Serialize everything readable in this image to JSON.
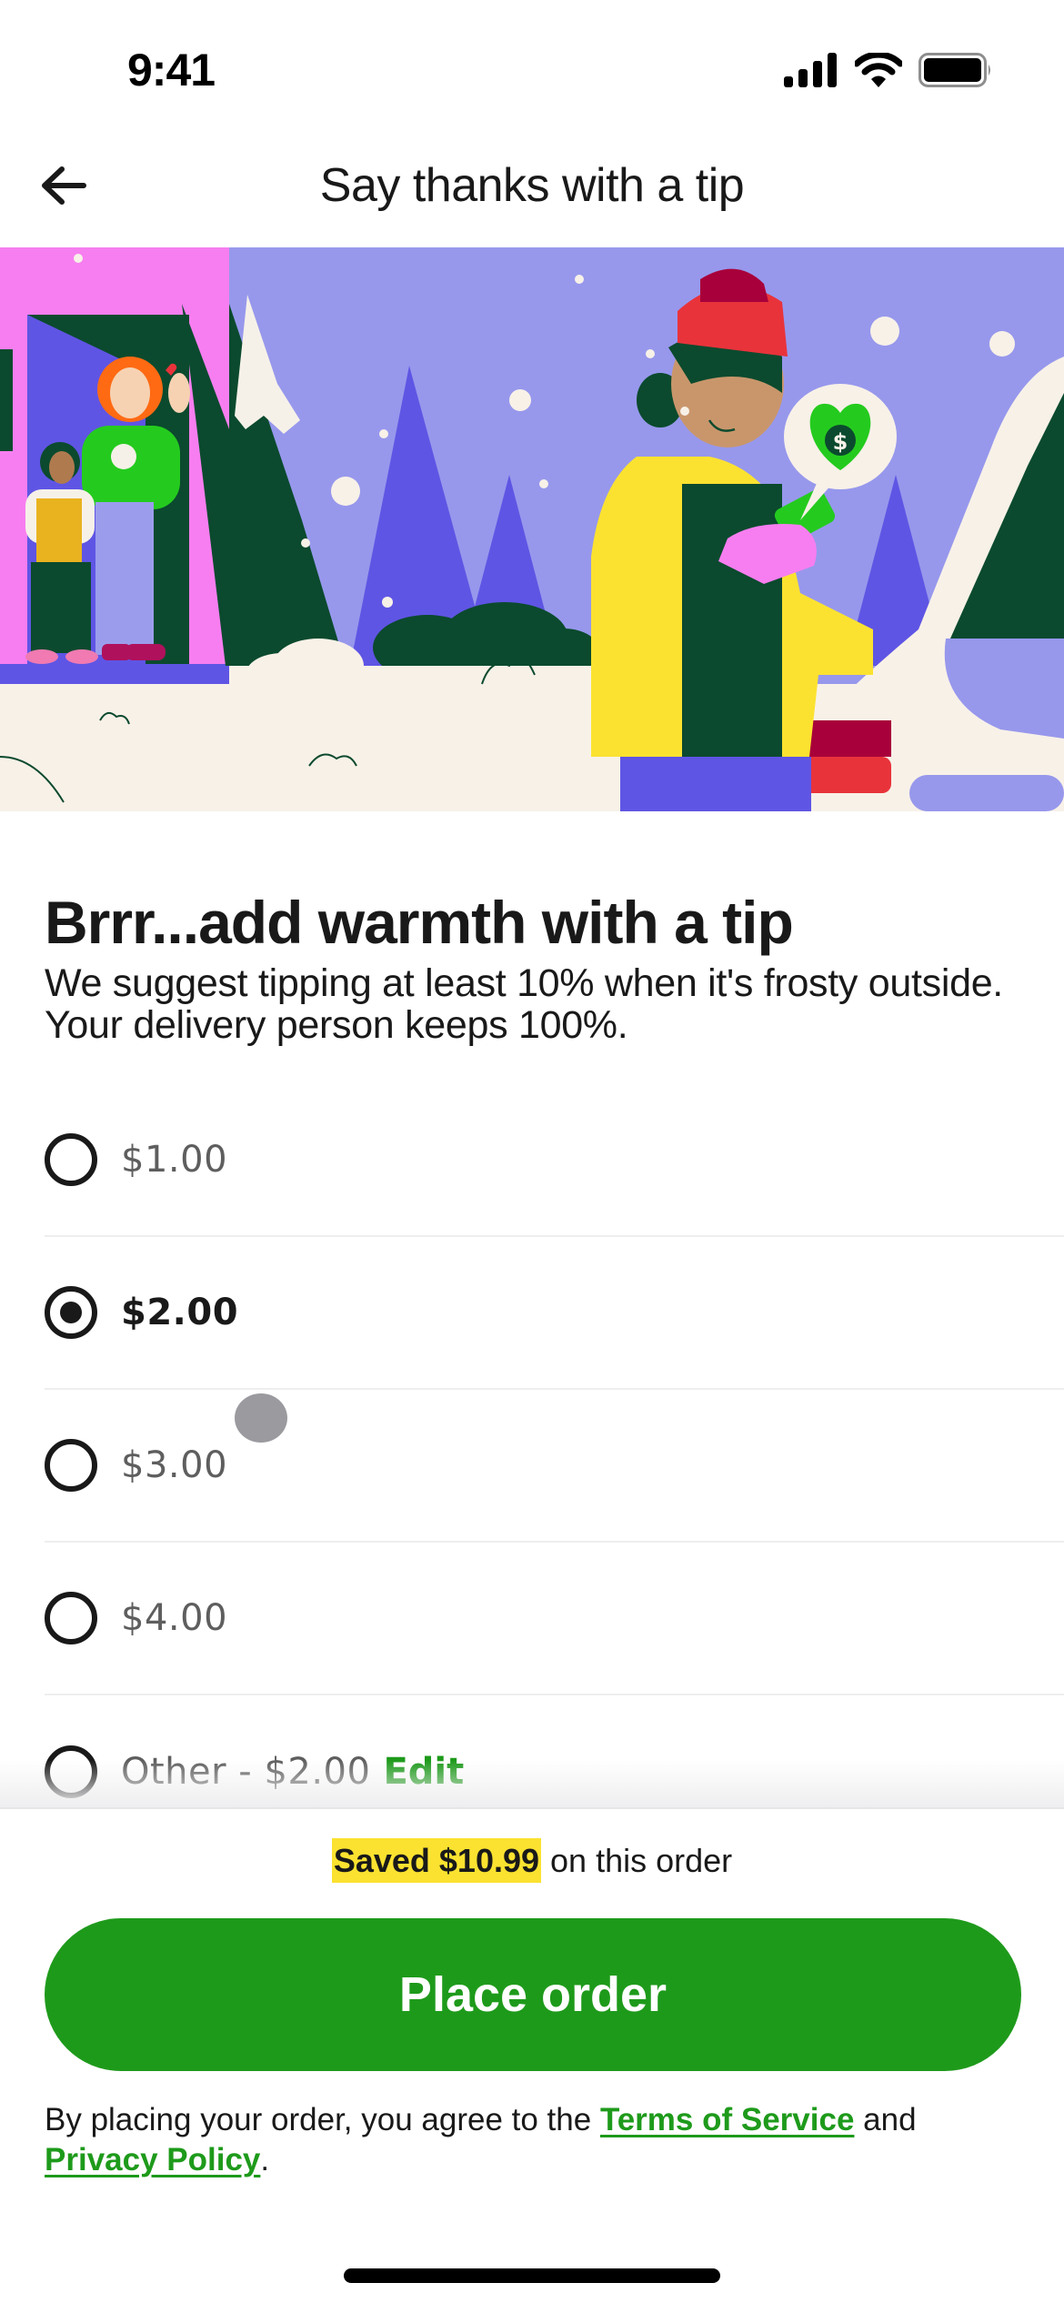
{
  "status_bar": {
    "time": "9:41",
    "icons": [
      "cellular-signal-icon",
      "wifi-icon",
      "battery-icon"
    ]
  },
  "nav": {
    "back_icon": "arrow-left-icon",
    "title": "Say thanks with a tip"
  },
  "hero": {
    "description": "Winter illustration: family waving from doorway, person in yellow coat and red beanie looking at phone with heart-dollar speech bubble, snowy trees",
    "bubble_icon": "heart-dollar-icon"
  },
  "content": {
    "headline": "Brrr...add warmth with a tip",
    "subtext": "We suggest tipping at least 10% when it's frosty outside. Your delivery person keeps 100%."
  },
  "tip_options": [
    {
      "label": "$1.00",
      "selected": false
    },
    {
      "label": "$2.00",
      "selected": true
    },
    {
      "label": "$3.00",
      "selected": false
    },
    {
      "label": "$4.00",
      "selected": false
    },
    {
      "label": "Other - $2.00",
      "selected": false,
      "action": "Edit"
    }
  ],
  "footer": {
    "savings_highlight": "Saved $10.99",
    "savings_rest": " on this order",
    "place_order_label": "Place order",
    "legal_prefix": "By placing your order, you agree to the ",
    "terms_label": "Terms of Service",
    "legal_and": " and ",
    "privacy_label": "Privacy Policy",
    "legal_suffix": "."
  },
  "colors": {
    "accent_green": "#1e9a1b",
    "highlight_yellow": "#fbe230",
    "text_primary": "#191919",
    "text_secondary": "#5e5e5e"
  }
}
